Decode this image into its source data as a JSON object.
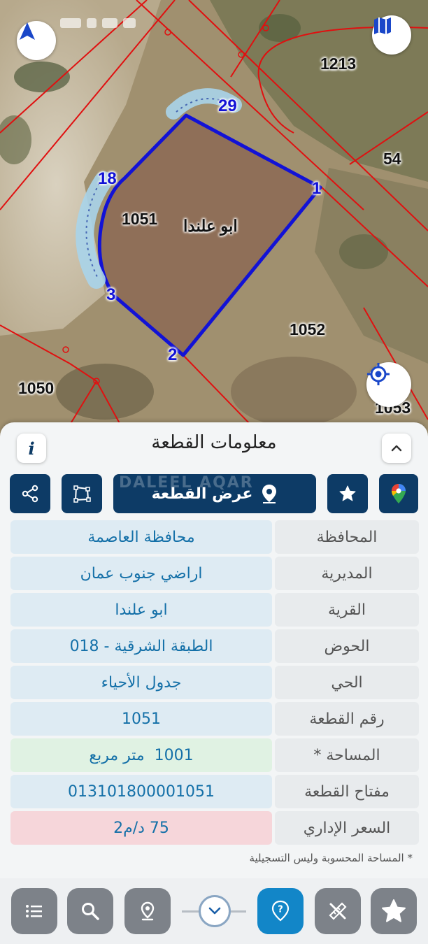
{
  "map": {
    "parcel_labels": [
      "1213",
      "54",
      "1051",
      "1052",
      "1050",
      "1053"
    ],
    "village_label": "ابو علندا",
    "vertex_labels": [
      "29",
      "18",
      "1",
      "3",
      "2"
    ],
    "compass_icon": "compass-arrow-icon",
    "layers_icon": "map-book-icon",
    "locate_icon": "crosshair-locate-icon"
  },
  "panel": {
    "title": "معلومات القطعة",
    "info_label": "i",
    "view_button_label": "عرض القطعة",
    "watermark": "DALEEL AQAR"
  },
  "details": [
    {
      "label": "المحافظة",
      "value": "محافظة العاصمة"
    },
    {
      "label": "المديرية",
      "value": "اراضي جنوب عمان"
    },
    {
      "label": "القرية",
      "value": "ابو علندا"
    },
    {
      "label": "الحوض",
      "value": "الطبقة الشرقية - 018"
    },
    {
      "label": "الحي",
      "value": "جدول الأحياء"
    },
    {
      "label": "رقم القطعة",
      "value": "1051"
    },
    {
      "label": "المساحة *",
      "value": "1001  متر مربع"
    },
    {
      "label": "مفتاح القطعة",
      "value": "013101800001051"
    },
    {
      "label": "السعر الإداري",
      "value": "75 د/م2"
    }
  ],
  "note": "* المساحة المحسوبة وليس التسجيلية",
  "colors": {
    "primary": "#0d3b66",
    "accent": "#1286c8",
    "value_text": "#1470a8",
    "parcel_outline": "#1212d6",
    "parcel_lines": "#e01010"
  }
}
